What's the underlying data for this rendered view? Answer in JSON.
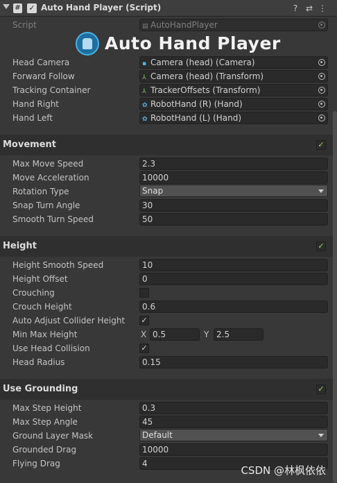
{
  "header": {
    "title": "Auto Hand Player (Script)",
    "script_icon": "#",
    "enabled_check": "✓",
    "icons": [
      "help-icon",
      "preset-icon",
      "more-icon"
    ],
    "help_glyph": "?",
    "preset_glyph": "⇄",
    "more_glyph": "⋮"
  },
  "script_row": {
    "label": "Script",
    "value": "AutoHandPlayer",
    "icon": "▤"
  },
  "banner": {
    "text": "Auto Hand Player"
  },
  "references": [
    {
      "label": "Head Camera",
      "value": "Camera (head) (Camera)",
      "icon": "▪"
    },
    {
      "label": "Forward Follow",
      "value": "Camera (head) (Transform)",
      "icon": "⅄"
    },
    {
      "label": "Tracking Container",
      "value": "TrackerOffsets (Transform)",
      "icon": "⅄"
    },
    {
      "label": "Hand Right",
      "value": "RobotHand (R) (Hand)",
      "icon": "✿"
    },
    {
      "label": "Hand Left",
      "value": "RobotHand (L) (Hand)",
      "icon": "✿"
    }
  ],
  "movement": {
    "title": "Movement",
    "check": "✓",
    "max_move_speed": {
      "label": "Max Move Speed",
      "value": "2.3"
    },
    "move_acceleration": {
      "label": "Move Acceleration",
      "value": "10000"
    },
    "rotation_type": {
      "label": "Rotation Type",
      "value": "Snap"
    },
    "snap_turn_angle": {
      "label": "Snap Turn Angle",
      "value": "30"
    },
    "smooth_turn_speed": {
      "label": "Smooth Turn Speed",
      "value": "50"
    }
  },
  "height": {
    "title": "Height",
    "check": "✓",
    "height_smooth_speed": {
      "label": "Height Smooth Speed",
      "value": "10"
    },
    "height_offset": {
      "label": "Height Offset",
      "value": "0"
    },
    "crouching": {
      "label": "Crouching",
      "value": ""
    },
    "crouch_height": {
      "label": "Crouch Height",
      "value": "0.6"
    },
    "auto_adjust": {
      "label": "Auto Adjust Collider Height",
      "value": "✓"
    },
    "min_max": {
      "label": "Min Max Height",
      "x_label": "X",
      "x": "0.5",
      "y_label": "Y",
      "y": "2.5"
    },
    "use_head_collision": {
      "label": "Use Head Collision",
      "value": "✓"
    },
    "head_radius": {
      "label": "Head Radius",
      "value": "0.15"
    }
  },
  "grounding": {
    "title": "Use Grounding",
    "check": "✓",
    "max_step_height": {
      "label": "Max Step Height",
      "value": "0.3"
    },
    "max_step_angle": {
      "label": "Max Step Angle",
      "value": "45"
    },
    "ground_layer_mask": {
      "label": "Ground Layer Mask",
      "value": "Default"
    },
    "grounded_drag": {
      "label": "Grounded Drag",
      "value": "10000"
    },
    "flying_drag": {
      "label": "Flying Drag",
      "value": "4"
    }
  },
  "watermark": "CSDN @林枫依依",
  "colors": {
    "background": "#383838",
    "field": "#2a2a2a",
    "section": "#2f2f2f",
    "check_green": "#9fd46a",
    "logo": "#1e6fa0"
  }
}
